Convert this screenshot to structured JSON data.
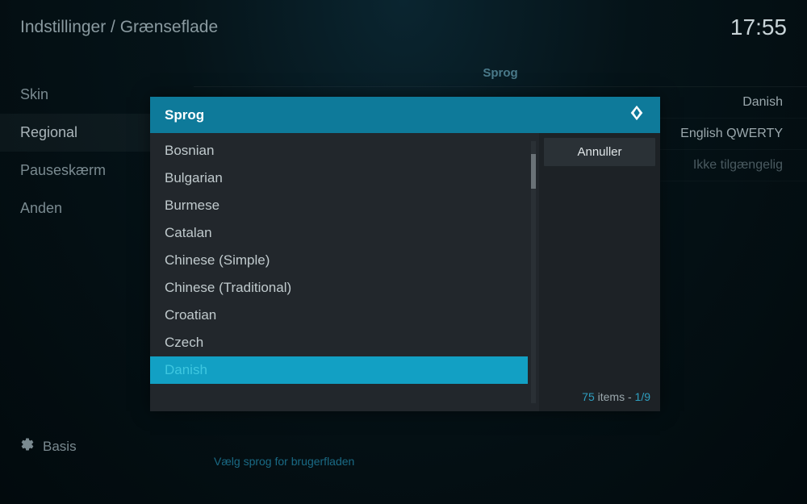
{
  "header": {
    "breadcrumb": "Indstillinger / Grænseflade",
    "clock": "17:55"
  },
  "sidebar": {
    "items": [
      {
        "label": "Skin",
        "active": false
      },
      {
        "label": "Regional",
        "active": true
      },
      {
        "label": "Pauseskærm",
        "active": false
      },
      {
        "label": "Anden",
        "active": false
      }
    ],
    "level_label": "Basis"
  },
  "content": {
    "section_title": "Sprog",
    "settings": [
      {
        "value": "Danish",
        "disabled": false
      },
      {
        "value": "English QWERTY",
        "disabled": false
      },
      {
        "value": "Ikke tilgængelig",
        "disabled": true
      }
    ],
    "footer_hint": "Vælg sprog for brugerfladen"
  },
  "dialog": {
    "title": "Sprog",
    "items": [
      {
        "label": "Bosnian",
        "state": ""
      },
      {
        "label": "Bulgarian",
        "state": ""
      },
      {
        "label": "Burmese",
        "state": ""
      },
      {
        "label": "Catalan",
        "state": ""
      },
      {
        "label": "Chinese (Simple)",
        "state": ""
      },
      {
        "label": "Chinese (Traditional)",
        "state": ""
      },
      {
        "label": "Croatian",
        "state": ""
      },
      {
        "label": "Czech",
        "state": ""
      },
      {
        "label": "Danish",
        "state": "selected current"
      }
    ],
    "cancel_label": "Annuller",
    "item_count": "75",
    "items_word": " items - ",
    "page": "1/9"
  }
}
